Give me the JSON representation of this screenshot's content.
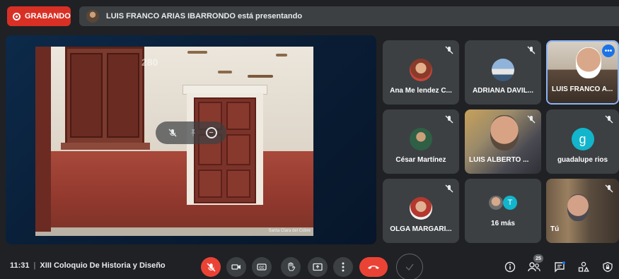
{
  "recording": {
    "label": "GRABANDO"
  },
  "presenting": {
    "text": "LUIS FRANCO ARIAS IBARRONDO está presentando"
  },
  "presentation": {
    "caption": "Santa Clara del Cobre",
    "watermark": "280"
  },
  "participants": [
    {
      "name": "Ana Me lendez C...",
      "muted": true,
      "kind": "photo"
    },
    {
      "name": "ADRIANA DAVIL...",
      "muted": true,
      "kind": "photo"
    },
    {
      "name": "LUIS FRANCO A...",
      "muted": false,
      "kind": "video",
      "active": true
    },
    {
      "name": "César Martínez",
      "muted": true,
      "kind": "photo"
    },
    {
      "name": "LUIS ALBERTO ...",
      "muted": true,
      "kind": "video"
    },
    {
      "name": "guadalupe rios",
      "muted": true,
      "kind": "letter",
      "letter": "g"
    },
    {
      "name": "OLGA MARGARI...",
      "muted": true,
      "kind": "photo"
    },
    {
      "name": "16 más",
      "muted": false,
      "kind": "more",
      "letter": "T"
    },
    {
      "name": "Tú",
      "muted": true,
      "kind": "video"
    }
  ],
  "bottom": {
    "time": "11:31",
    "separator": "|",
    "meeting_title": "XIII Coloquio De Historia y Diseño",
    "participant_count": "25"
  },
  "colors": {
    "accent_red": "#ea4335",
    "background": "#202124",
    "tile": "#3c4043",
    "blue": "#1a73e8"
  }
}
